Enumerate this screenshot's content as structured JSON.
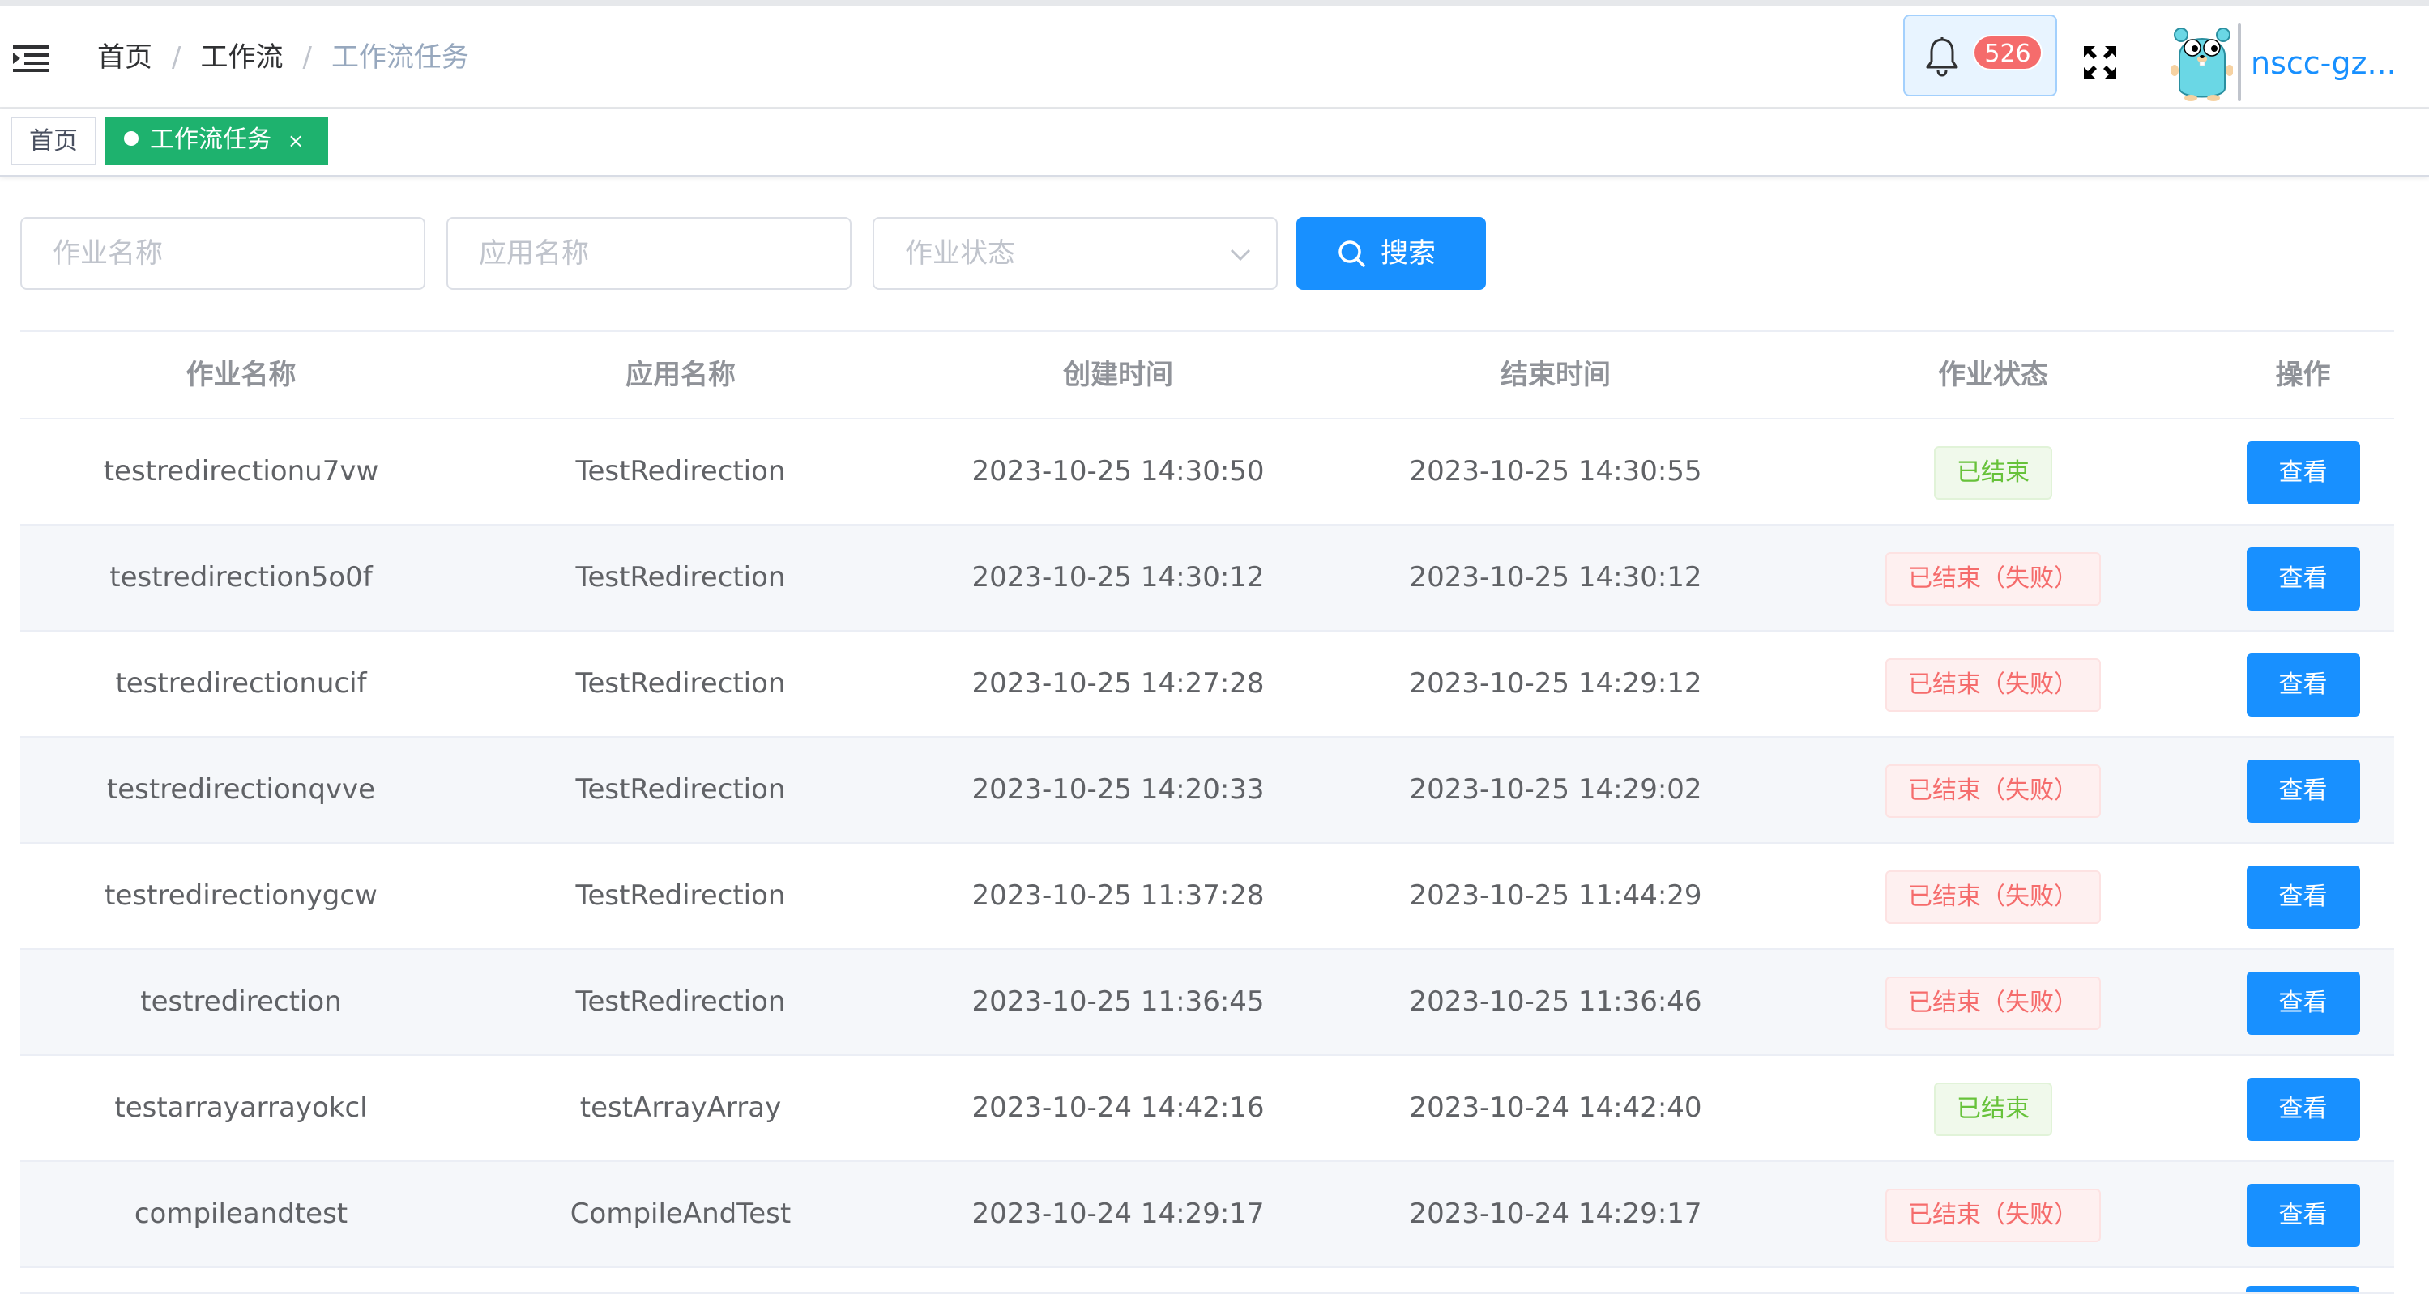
{
  "breadcrumb": [
    "首页",
    "工作流",
    "工作流任务"
  ],
  "notifications": {
    "count": "526"
  },
  "user": {
    "name": "nscc-gz..."
  },
  "tags": {
    "home": "首页",
    "active": "工作流任务",
    "close": "×"
  },
  "filters": {
    "job_placeholder": "作业名称",
    "app_placeholder": "应用名称",
    "status_placeholder": "作业状态",
    "search_label": "搜索"
  },
  "table": {
    "headers": [
      "作业名称",
      "应用名称",
      "创建时间",
      "结束时间",
      "作业状态",
      "操作"
    ],
    "rows": [
      {
        "name": "testredirectionu7vw",
        "app": "TestRedirection",
        "created": "2023-10-25 14:30:50",
        "ended": "2023-10-25 14:30:55",
        "status": "已结束",
        "action": "查看"
      },
      {
        "name": "testredirection5o0f",
        "app": "TestRedirection",
        "created": "2023-10-25 14:30:12",
        "ended": "2023-10-25 14:30:12",
        "status": "已结束（失败）",
        "action": "查看"
      },
      {
        "name": "testredirectionucif",
        "app": "TestRedirection",
        "created": "2023-10-25 14:27:28",
        "ended": "2023-10-25 14:29:12",
        "status": "已结束（失败）",
        "action": "查看"
      },
      {
        "name": "testredirectionqvve",
        "app": "TestRedirection",
        "created": "2023-10-25 14:20:33",
        "ended": "2023-10-25 14:29:02",
        "status": "已结束（失败）",
        "action": "查看"
      },
      {
        "name": "testredirectionygcw",
        "app": "TestRedirection",
        "created": "2023-10-25 11:37:28",
        "ended": "2023-10-25 11:44:29",
        "status": "已结束（失败）",
        "action": "查看"
      },
      {
        "name": "testredirection",
        "app": "TestRedirection",
        "created": "2023-10-25 11:36:45",
        "ended": "2023-10-25 11:36:46",
        "status": "已结束（失败）",
        "action": "查看"
      },
      {
        "name": "testarrayarrayokcl",
        "app": "testArrayArray",
        "created": "2023-10-24 14:42:16",
        "ended": "2023-10-24 14:42:40",
        "status": "已结束",
        "action": "查看"
      },
      {
        "name": "compileandtest",
        "app": "CompileAndTest",
        "created": "2023-10-24 14:29:17",
        "ended": "2023-10-24 14:29:17",
        "status": "已结束（失败）",
        "action": "查看"
      }
    ]
  },
  "colors": {
    "primary": "#1890ff",
    "tag_green": "#1eb26e",
    "badge_red": "#f56c6c",
    "success": "#67c23a",
    "danger": "#f56c6c"
  },
  "icons": [
    "hamburger-icon",
    "bell-icon",
    "fullscreen-icon",
    "search-icon",
    "chevron-down-icon",
    "gopher-avatar"
  ]
}
